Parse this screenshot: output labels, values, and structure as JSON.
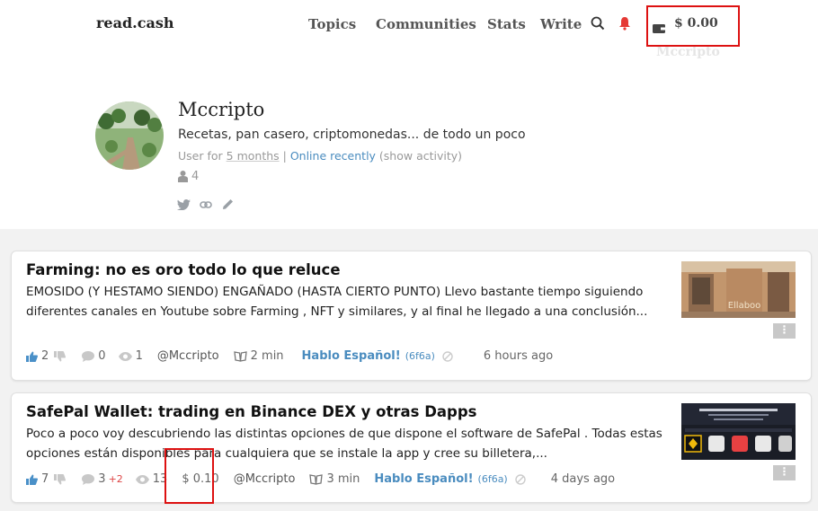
{
  "header": {
    "logo": "read.cash",
    "nav": [
      "Topics",
      "Communities",
      "Stats",
      "Write"
    ],
    "wallet_amount": "$ 0.00",
    "wallet_user": "Mccripto",
    "accent_color": "#d11111"
  },
  "profile": {
    "name": "Mccripto",
    "bio": "Recetas, pan casero, criptomonedas... de todo un poco",
    "user_for_prefix": "User for ",
    "user_for_value": "5 months",
    "separator": " | ",
    "online": "Online recently",
    "show_activity": " (show activity)",
    "followers": "4"
  },
  "posts": [
    {
      "title": "Farming: no es oro todo lo que reluce",
      "excerpt": "EMOSIDO (Y HESTAMO SIENDO) ENGAÑADO (HASTA CIERTO PUNTO) Llevo bastante tiempo siguiendo diferentes canales en Youtube sobre Farming , NFT y similares, y al final he llegado a una conclusión...",
      "upvotes": "2",
      "comments": "0",
      "comments_extra": "",
      "views": "1",
      "earnings": "",
      "author": "@Mccripto",
      "read_time": "2 min",
      "community": "Hablo Español!",
      "community_code": "(6f6a)",
      "time": "6 hours ago",
      "thumb_icon": "house-photo"
    },
    {
      "title": "SafePal Wallet: trading en Binance DEX y otras Dapps",
      "excerpt": "Poco a poco voy descubriendo las distintas opciones de que dispone el software de SafePal . Todas estas opciones están disponibles para cualquiera que se instale la app y cree su billetera,...",
      "upvotes": "7",
      "comments": "3",
      "comments_extra": "+2",
      "views": "13",
      "earnings": "$ 0.10",
      "author": "@Mccripto",
      "read_time": "3 min",
      "community": "Hablo Español!",
      "community_code": "(6f6a)",
      "time": "4 days ago",
      "thumb_icon": "binance-dapp-screenshot"
    }
  ]
}
